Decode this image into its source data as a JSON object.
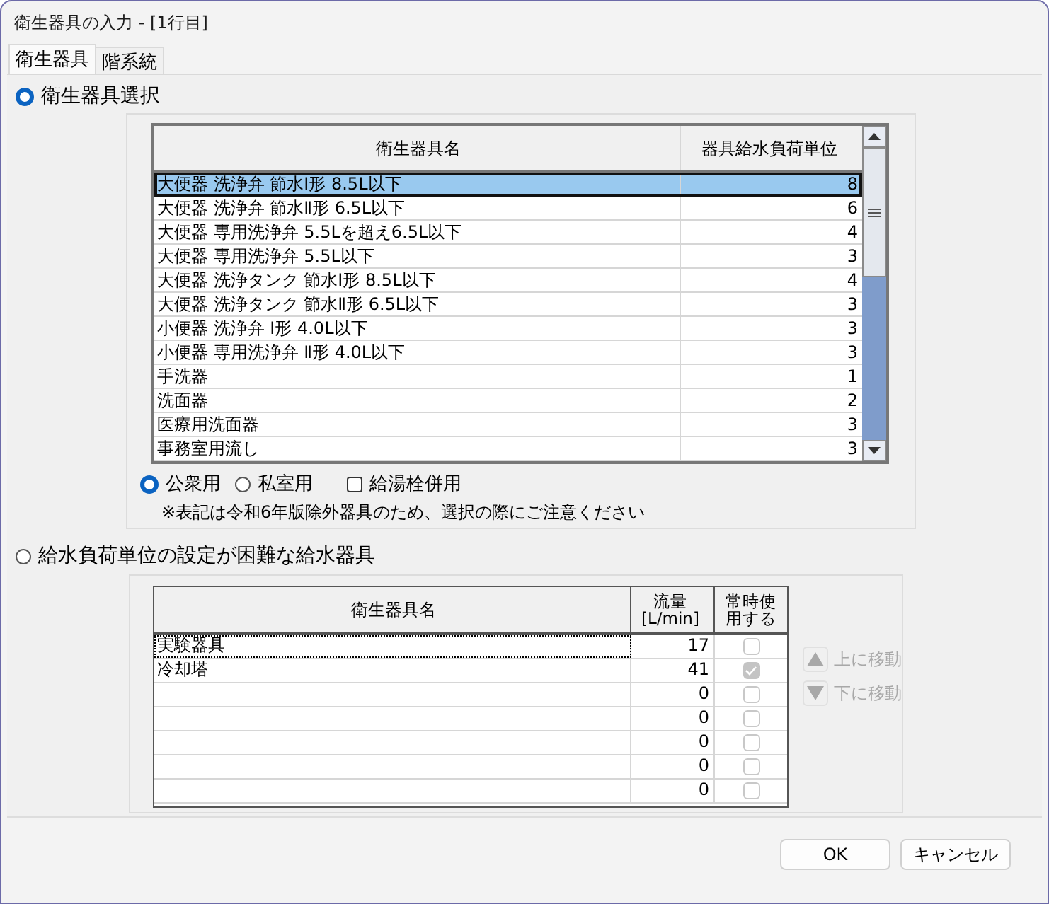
{
  "window": {
    "title": "衛生器具の入力 - [1行目]"
  },
  "tabs": [
    {
      "label": "衛生器具",
      "selected": true
    },
    {
      "label": "階系統",
      "selected": false
    }
  ],
  "fixture_section": {
    "label": "衛生器具選択",
    "selected": true
  },
  "fixture_table": {
    "columns": [
      "衛生器具名",
      "器具給水負荷単位"
    ],
    "rows": [
      {
        "name": "大便器 洗浄弁 節水Ⅰ形 8.5L以下",
        "unit": "8",
        "selected": true
      },
      {
        "name": "大便器 洗浄弁 節水Ⅱ形 6.5L以下",
        "unit": "6",
        "selected": false
      },
      {
        "name": "大便器 専用洗浄弁 5.5Lを超え6.5L以下",
        "unit": "4",
        "selected": false
      },
      {
        "name": "大便器 専用洗浄弁 5.5L以下",
        "unit": "3",
        "selected": false
      },
      {
        "name": "大便器 洗浄タンク 節水Ⅰ形 8.5L以下",
        "unit": "4",
        "selected": false
      },
      {
        "name": "大便器 洗浄タンク 節水Ⅱ形 6.5L以下",
        "unit": "3",
        "selected": false
      },
      {
        "name": "小便器 洗浄弁 Ⅰ形 4.0L以下",
        "unit": "3",
        "selected": false
      },
      {
        "name": "小便器 専用洗浄弁 Ⅱ形 4.0L以下",
        "unit": "3",
        "selected": false
      },
      {
        "name": "手洗器",
        "unit": "1",
        "selected": false
      },
      {
        "name": "洗面器",
        "unit": "2",
        "selected": false
      },
      {
        "name": "医療用洗面器",
        "unit": "3",
        "selected": false
      },
      {
        "name": "事務室用流し",
        "unit": "3",
        "selected": false
      }
    ]
  },
  "usage": [
    {
      "label": "公衆用",
      "selected": true
    },
    {
      "label": "私室用",
      "selected": false
    }
  ],
  "hot_water": {
    "label": "給湯栓併用",
    "checked": false
  },
  "note": "※表記は令和6年版除外器具のため、選択の際にご注意ください",
  "special_section": {
    "label": "給水負荷単位の設定が困難な給水器具",
    "selected": false
  },
  "special_table": {
    "columns": [
      "衛生器具名",
      "流量\n[L/min]",
      "常時使用する"
    ],
    "rows": [
      {
        "name": "実験器具",
        "flow": "17",
        "checked": false,
        "focused": true
      },
      {
        "name": "冷却塔",
        "flow": "41",
        "checked": true,
        "focused": false
      },
      {
        "name": "",
        "flow": "0",
        "checked": false,
        "focused": false
      },
      {
        "name": "",
        "flow": "0",
        "checked": false,
        "focused": false
      },
      {
        "name": "",
        "flow": "0",
        "checked": false,
        "focused": false
      },
      {
        "name": "",
        "flow": "0",
        "checked": false,
        "focused": false
      },
      {
        "name": "",
        "flow": "0",
        "checked": false,
        "focused": false
      }
    ]
  },
  "move_buttons": [
    {
      "label": "上に移動",
      "kind": "up",
      "disabled": true
    },
    {
      "label": "下に移動",
      "kind": "down",
      "disabled": true
    }
  ],
  "buttons": [
    "OK",
    "キャンセル"
  ]
}
